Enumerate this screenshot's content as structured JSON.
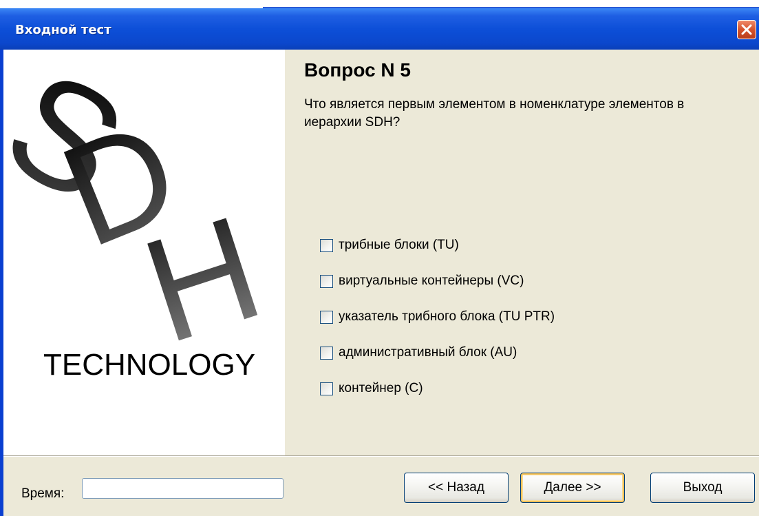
{
  "window": {
    "title": "Входной тест",
    "close_icon": "close-icon"
  },
  "logo": {
    "letters": "SDH",
    "word": "TECHNOLOGY"
  },
  "question": {
    "title": "Вопрос N 5",
    "text": "Что является первым элементом в номенклатуре элементов в иерархии SDH?"
  },
  "options": [
    {
      "label": "трибные блоки (TU)",
      "checked": false
    },
    {
      "label": "виртуальные контейнеры (VC)",
      "checked": false
    },
    {
      "label": "указатель трибного блока (TU PTR)",
      "checked": false
    },
    {
      "label": "административный блок (AU)",
      "checked": false
    },
    {
      "label": "контейнер (С)",
      "checked": false
    }
  ],
  "footer": {
    "time_label": "Время:",
    "time_value": "",
    "back_label": "<< Назад",
    "next_label": "Далее >>",
    "exit_label": "Выход"
  },
  "colors": {
    "titlebar": "#0b47cc",
    "client_bg": "#ece9d8",
    "close_button": "#d5532c"
  }
}
